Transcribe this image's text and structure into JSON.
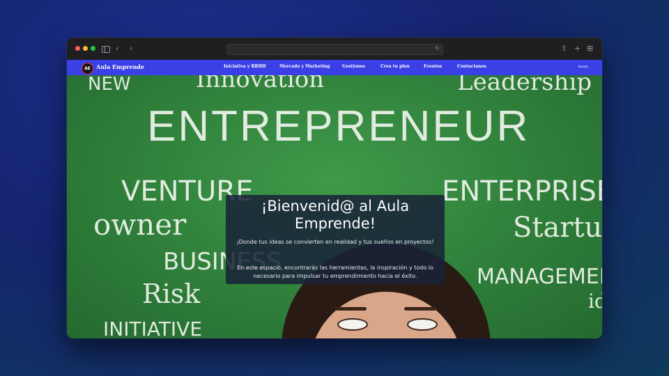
{
  "navbar": {
    "brand": "Aula Emprende",
    "logo_text": "AE",
    "links": [
      "Iniciativa y RRHH",
      "Mercado y Marketing",
      "Gestiones",
      "Crea tu plan",
      "Eventos",
      "Contactanos"
    ],
    "user": "daoys"
  },
  "hero": {
    "board_words": [
      "Innovation",
      "NEW",
      "Leadership",
      "ENTREPRENEUR",
      "VENTURE",
      "ENTERPRISE",
      "owner",
      "Startup",
      "BUSINESS",
      "Risk",
      "MANAGEMENT",
      "INITIATIVE",
      "ideas"
    ],
    "board_color": "#2f7f3a",
    "title": "¡Bienvenid@ al Aula Emprende!",
    "subtitle": "¡Donde tus ideas se convierten en realidad y tus sueños en proyectos!",
    "body": "En este espacio, encontrarás las herramientas, la inspiración y todo lo necesario para impulsar tu emprendimiento hacia el éxito."
  },
  "colors": {
    "navbar": "#3b3fe6",
    "panel": "#182238"
  }
}
